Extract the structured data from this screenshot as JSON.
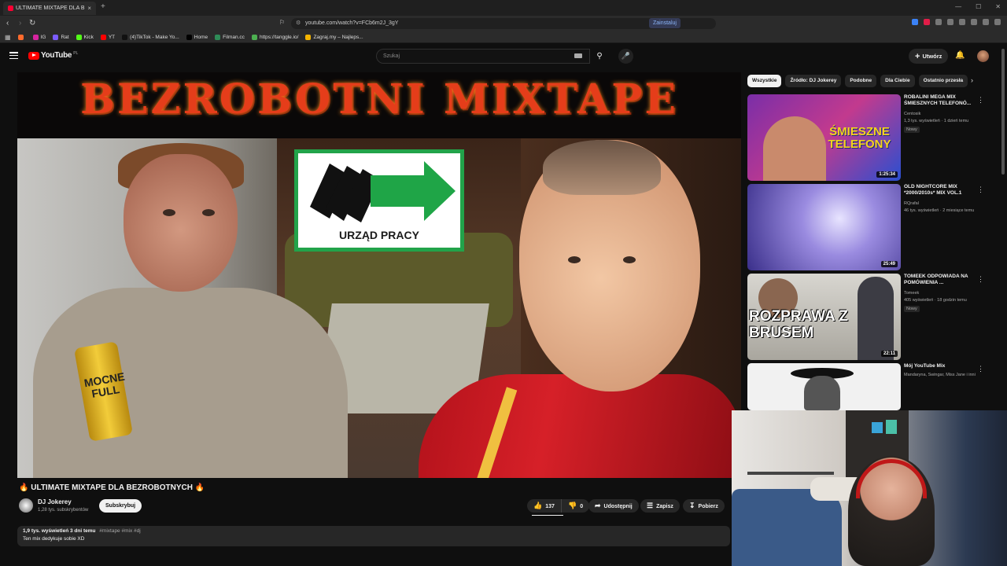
{
  "browser": {
    "tab_title": "ULTIMATE MIXTAPE DLA B",
    "tab_close": "×",
    "new_tab": "+",
    "url": "youtube.com/watch?v=FCb6m2J_3gY",
    "install_label": "Zainstaluj",
    "bookmarks": [
      {
        "label": "",
        "color": "#ff6b2d"
      },
      {
        "label": "IG",
        "color": "#d6249f"
      },
      {
        "label": "Rat",
        "color": "#7b5cff"
      },
      {
        "label": "Kick",
        "color": "#53fc18"
      },
      {
        "label": "YT",
        "color": "#ff0000"
      },
      {
        "label": "(4)TikTok - Make Yo...",
        "color": "#111111"
      },
      {
        "label": "Home",
        "color": "#000000"
      },
      {
        "label": "Filman.cc",
        "color": "#2e8b57"
      },
      {
        "label": "https://tanggle.io/",
        "color": "#4caf50"
      },
      {
        "label": "Zagraj.my – Najleps...",
        "color": "#f4b400"
      }
    ]
  },
  "youtube": {
    "logo_text": "YouTube",
    "country_code": "PL",
    "search_placeholder": "Szukaj",
    "create_label": "Utwórz",
    "create_plus": "+"
  },
  "thumbnail": {
    "title": "BEZROBOTNI MIXTAPE",
    "sign_text": "URZĄD PRACY",
    "can_text": "MOCNE FULL"
  },
  "video": {
    "title": "🔥 ULTIMATE MIXTAPE DLA BEZROBOTNYCH 🔥",
    "channel": "DJ Jokerey",
    "subscribers": "1,28 tys. subskrybentów",
    "subscribe_label": "Subskrybuj",
    "likes": "137",
    "dislikes": "0",
    "share_label": "Udostępnij",
    "save_label": "Zapisz",
    "download_label": "Pobierz",
    "views_date": "1,9 tys. wyświetleń  3 dni temu",
    "tags": "#mixtape #mix #dj",
    "description": "Ten mix dedykuje sobie XD"
  },
  "chips": [
    {
      "label": "Wszystkie",
      "active": true
    },
    {
      "label": "Źródło: DJ Jokerey",
      "active": false
    },
    {
      "label": "Podobne",
      "active": false
    },
    {
      "label": "Dla Ciebie",
      "active": false
    },
    {
      "label": "Ostatnio przesła",
      "active": false
    }
  ],
  "recommendations": [
    {
      "title": "ROBALINI MEGA MIX ŚMIESZNYCH TELEFONÓ...",
      "channel": "Centosik",
      "meta": "1,3 tys. wyświetleń · 1 dzień temu",
      "badge": "Nowy",
      "duration": "1:25:34",
      "thumb_text": "ŚMIESZNE TELEFONY"
    },
    {
      "title": "OLD NIGHTCORE MIX *2000/2010s* MIX VOL.1",
      "channel": "RQrafal",
      "meta": "46 tys. wyświetleń · 2 miesiące temu",
      "badge": "",
      "duration": "25:49",
      "thumb_text": ""
    },
    {
      "title": "TOMEEK ODPOWIADA NA POMÓWIENIA ...",
      "channel": "Tomeek",
      "meta": "405 wyświetleń · 18 godzin temu",
      "badge": "Nowy",
      "duration": "22:11",
      "thumb_text": "ROZPRAWA Z BRUSEM"
    },
    {
      "title": "Mój YouTube Mix",
      "channel": "Mandaryna, Swingar, Miss Jane i inni",
      "meta": "",
      "badge": "",
      "duration": "",
      "thumb_text": ""
    }
  ]
}
